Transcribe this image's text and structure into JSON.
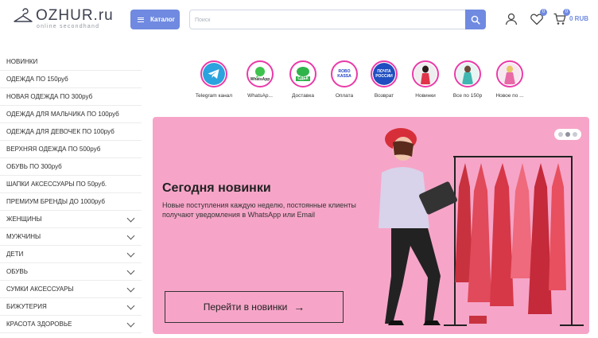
{
  "header": {
    "logo_text": "OZHUR.ru",
    "logo_sub": "online secondhand",
    "catalog_label": "Каталог",
    "search_placeholder": "Поиск",
    "favorites_count": "0",
    "cart_count": "0",
    "cart_total": "0 RUB"
  },
  "sidebar": {
    "items": [
      {
        "label": "НОВИНКИ",
        "has_children": false
      },
      {
        "label": "ОДЕЖДА ПО 150руб",
        "has_children": false
      },
      {
        "label": "НОВАЯ ОДЕЖДА ПО 300руб",
        "has_children": false
      },
      {
        "label": "ОДЕЖДА ДЛЯ МАЛЬЧИКА ПО 100руб",
        "has_children": false
      },
      {
        "label": "ОДЕЖДА ДЛЯ ДЕВОЧЕК ПО 100руб",
        "has_children": false
      },
      {
        "label": "ВЕРХНЯЯ ОДЕЖДА ПО 500руб",
        "has_children": false
      },
      {
        "label": "ОБУВЬ ПО 300руб",
        "has_children": false
      },
      {
        "label": "ШАПКИ АКСЕССУАРЫ ПО 50руб.",
        "has_children": false
      },
      {
        "label": "ПРЕМИУМ БРЕНДЫ ДО 1000руб",
        "has_children": false
      },
      {
        "label": "ЖЕНЩИНЫ",
        "has_children": true
      },
      {
        "label": "МУЖЧИНЫ",
        "has_children": true
      },
      {
        "label": "ДЕТИ",
        "has_children": true
      },
      {
        "label": "ОБУВЬ",
        "has_children": true
      },
      {
        "label": "СУМКИ АКСЕССУАРЫ",
        "has_children": true
      },
      {
        "label": "БИЖУТЕРИЯ",
        "has_children": true
      },
      {
        "label": "КРАСОТА ЗДОРОВЬЕ",
        "has_children": true
      }
    ]
  },
  "stories": [
    {
      "label": "Telegram канал",
      "icon": "telegram-icon",
      "icon_text": ""
    },
    {
      "label": "WhatsAp...",
      "icon": "whatsapp-icon",
      "icon_text": "WhatsApp"
    },
    {
      "label": "Доставка",
      "icon": "sdek-icon",
      "icon_text": "СДЕК"
    },
    {
      "label": "Оплата",
      "icon": "robokassa-icon",
      "icon_text": "ROBO KASSA"
    },
    {
      "label": "Возврат",
      "icon": "russian-post-icon",
      "icon_text": "ПОЧТА РОССИИ"
    },
    {
      "label": "Новинки",
      "icon": "new-arrivals-icon",
      "icon_text": ""
    },
    {
      "label": "Все по 150р",
      "icon": "all-150-icon",
      "icon_text": ""
    },
    {
      "label": "Новое по ...",
      "icon": "new-300-icon",
      "icon_text": ""
    }
  ],
  "banner": {
    "title": "Сегодня новинки",
    "text": "Новые поступления каждую неделю, постоянные клиенты получают уведомления в WhatsApp или Email",
    "button_label": "Перейти в новинки",
    "slides": 3,
    "active_slide": 1
  },
  "colors": {
    "accent": "#6f8ae0",
    "banner_bg": "#f6a5c8",
    "story_ring": "#ea3aa8"
  }
}
